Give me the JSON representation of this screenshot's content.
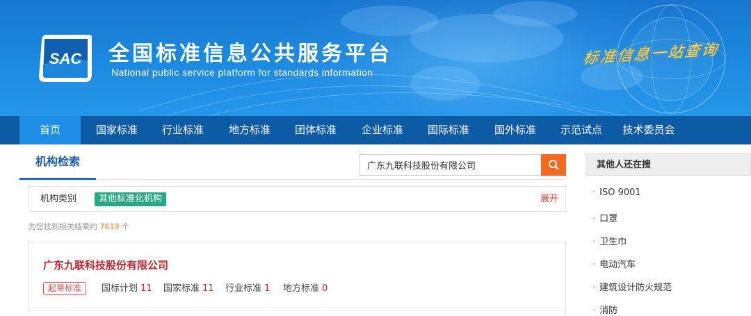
{
  "banner": {
    "logo_text": "SAC",
    "title": "全国标准信息公共服务平台",
    "subtitle": "National public service platform  for standards information",
    "slogan": "标准信息一站查询",
    "colors": {
      "banner": "#1c8ae0",
      "nav": "#0d5aa5",
      "nav_active": "#1f8ee6",
      "slogan": "#ffd24a"
    }
  },
  "nav": {
    "items": [
      "首页",
      "国家标准",
      "行业标准",
      "地方标准",
      "团体标准",
      "企业标准",
      "国际标准",
      "国外标准",
      "示范试点",
      "技术委员会"
    ],
    "active_index": 0
  },
  "search": {
    "section_title": "机构检索",
    "query": "广东九联科技股份有限公司",
    "button_icon": "search-icon",
    "button_color": "#f76a1c"
  },
  "filter": {
    "label": "机构类别",
    "selected": "其他标准化机构",
    "expand_label": "展开"
  },
  "results": {
    "count_prefix": "为您找到相关结果约",
    "count": "7619",
    "count_suffix": "个",
    "items": [
      {
        "name": "广东九联科技股份有限公司",
        "tag": "起草标准",
        "stats": [
          {
            "label": "国标计划",
            "value": "11"
          },
          {
            "label": "国家标准",
            "value": "11"
          },
          {
            "label": "行业标准",
            "value": "1"
          },
          {
            "label": "地方标准",
            "value": "0"
          }
        ]
      }
    ]
  },
  "sidebar": {
    "title": "其他人还在搜",
    "items": [
      "ISO 9001",
      "口罩",
      "卫生巾",
      "电动汽车",
      "建筑设计防火规范",
      "消防"
    ]
  }
}
